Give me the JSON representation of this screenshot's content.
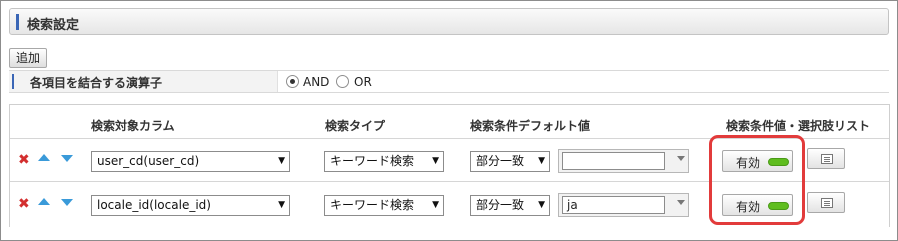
{
  "header": {
    "title": "検索設定"
  },
  "toolbar": {
    "add_label": "追加"
  },
  "operator": {
    "label": "各項目を結合する演算子",
    "options": [
      {
        "label": "AND",
        "checked": true
      },
      {
        "label": "OR",
        "checked": false
      }
    ]
  },
  "table": {
    "columns": [
      "検索対象カラム",
      "検索タイプ",
      "検索条件デフォルト値",
      "検索条件値・選択肢リスト"
    ],
    "rows": [
      {
        "column": "user_cd(user_cd)",
        "search_type": "キーワード検索",
        "match": "部分一致",
        "default_value": "",
        "enable_label": "有効"
      },
      {
        "column": "locale_id(locale_id)",
        "search_type": "キーワード検索",
        "match": "部分一致",
        "default_value": "ja",
        "enable_label": "有効"
      }
    ]
  },
  "icons": {
    "delete": "delete-x-icon",
    "up": "arrow-up-icon",
    "down": "arrow-down-icon",
    "list": "list-icon",
    "toggle": "toggle-on-icon"
  },
  "colors": {
    "accent": "#3a66b6",
    "delete": "#d32f2f",
    "arrows": "#3a9ad9",
    "toggle_on": "#5fbd1f",
    "highlight": "#e23b3b"
  }
}
